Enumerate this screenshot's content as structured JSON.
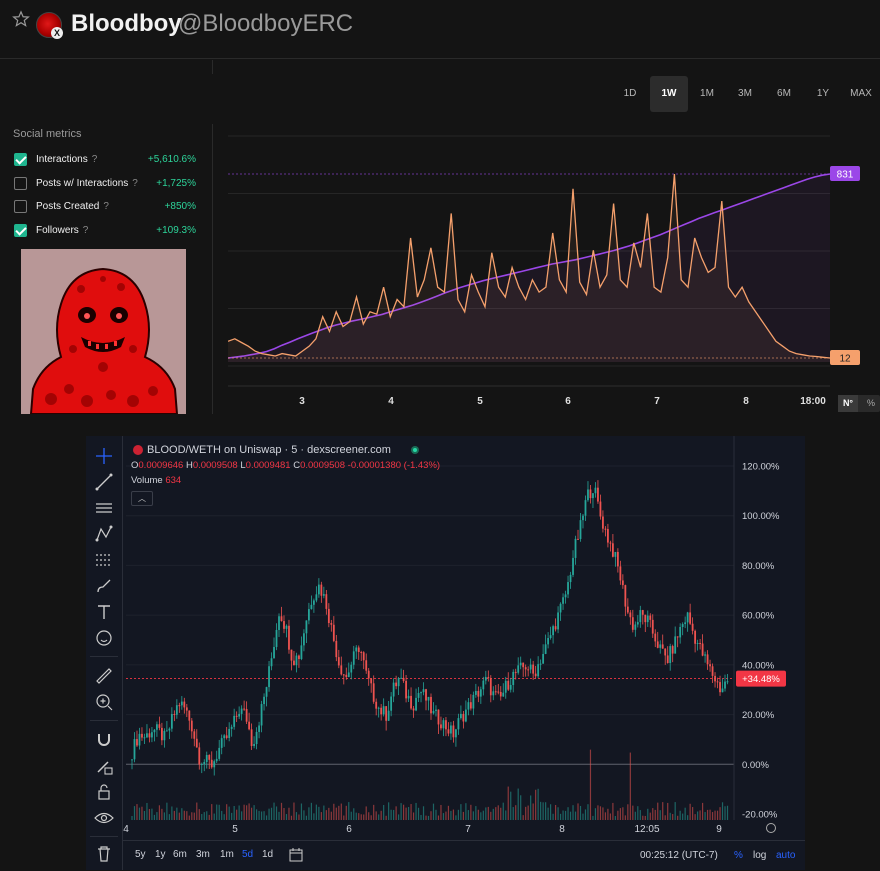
{
  "header": {
    "name": "Bloodboy",
    "handle": "@BloodboyERC"
  },
  "social_metrics": {
    "title": "Social metrics",
    "items": [
      {
        "label": "Interactions",
        "help": "?",
        "value": "+5,610.6%",
        "checked": true
      },
      {
        "label": "Posts w/ Interactions",
        "help": "?",
        "value": "+1,725%",
        "checked": false
      },
      {
        "label": "Posts Created",
        "help": "?",
        "value": "+850%",
        "checked": false
      },
      {
        "label": "Followers",
        "help": "?",
        "value": "+109.3%",
        "checked": true
      }
    ]
  },
  "ranges": [
    "1D",
    "1W",
    "1M",
    "3M",
    "6M",
    "1Y",
    "MAX"
  ],
  "active_range": "1W",
  "unit_toggle": {
    "count": "N°",
    "percent": "%"
  },
  "colors": {
    "followers": "#9b47e8",
    "interactions": "#f5a06c",
    "up": "#26a69a",
    "down": "#ef5350",
    "accent_green": "#2dd49a"
  },
  "chart_data": [
    {
      "type": "line",
      "x_ticks": [
        "3",
        "4",
        "5",
        "6",
        "7",
        "8",
        "18:00"
      ],
      "series": [
        {
          "name": "Followers",
          "color": "#9b47e8",
          "end_label": "831",
          "values": [
            40,
            44,
            48,
            54,
            60,
            68,
            80,
            95,
            108,
            122,
            135,
            148,
            160,
            172,
            182,
            190,
            198,
            205,
            212,
            220,
            228,
            238,
            248,
            258,
            268,
            280,
            292,
            305,
            318,
            330,
            342,
            352,
            362,
            372,
            380,
            388,
            396,
            404,
            412,
            420,
            428,
            436,
            444,
            450,
            456,
            462,
            470,
            478,
            486,
            494,
            502,
            512,
            522,
            534,
            546,
            558,
            570,
            584,
            598,
            612,
            626,
            640,
            652,
            664,
            676,
            688,
            700,
            712,
            724,
            736,
            748,
            760,
            772,
            784,
            796,
            808,
            818,
            826,
            831
          ]
        },
        {
          "name": "Interactions",
          "color": "#f5a06c",
          "end_label": "12",
          "values": [
            80,
            90,
            75,
            60,
            40,
            30,
            25,
            20,
            30,
            25,
            20,
            40,
            60,
            90,
            180,
            120,
            200,
            140,
            160,
            260,
            150,
            200,
            190,
            300,
            180,
            250,
            220,
            500,
            260,
            330,
            460,
            300,
            280,
            600,
            250,
            200,
            350,
            280,
            220,
            440,
            300,
            260,
            380,
            300,
            250,
            330,
            280,
            300,
            520,
            330,
            280,
            700,
            320,
            270,
            450,
            300,
            350,
            640,
            330,
            300,
            480,
            380,
            600,
            300,
            280,
            420,
            760,
            330,
            300,
            500,
            420,
            360,
            380,
            650,
            300,
            260,
            300,
            240,
            200,
            160,
            120,
            80,
            60,
            40,
            30,
            25,
            20,
            18,
            15,
            12
          ]
        }
      ]
    },
    {
      "type": "candlestick",
      "title": "BLOOD/WETH on Uniswap · 5 · dexscreener.com",
      "ohlc": {
        "O": "0.0009646",
        "H": "0.0009508",
        "L": "0.0009481",
        "C": "0.0009508",
        "change": "-0.00001380 (-1.43%)"
      },
      "volume_label": "Volume",
      "volume_value": "634",
      "y_axis_labels": [
        "120.00%",
        "100.00%",
        "80.00%",
        "60.00%",
        "40.00%",
        "20.00%",
        "0.00%",
        "-20.00%"
      ],
      "ylim": [
        -20,
        120
      ],
      "current_label": "+34.48%",
      "current_value": 34.48,
      "x_ticks": [
        "4",
        "5",
        "6",
        "7",
        "8",
        "12:05",
        "9"
      ],
      "close_path": [
        5,
        12,
        11,
        14,
        13,
        10,
        18,
        25,
        22,
        15,
        3,
        1,
        0,
        6,
        10,
        15,
        22,
        20,
        8,
        18,
        30,
        45,
        62,
        55,
        42,
        44,
        58,
        68,
        72,
        65,
        52,
        40,
        35,
        42,
        48,
        36,
        28,
        22,
        20,
        30,
        35,
        28,
        24,
        30,
        26,
        20,
        18,
        15,
        12,
        18,
        22,
        26,
        30,
        34,
        28,
        26,
        32,
        36,
        38,
        40,
        36,
        42,
        48,
        55,
        62,
        70,
        85,
        95,
        108,
        112,
        100,
        92,
        85,
        75,
        62,
        55,
        60,
        58,
        52,
        46,
        42,
        48,
        55,
        60,
        52,
        46,
        40,
        35,
        30,
        34
      ]
    }
  ],
  "dex_bottom": {
    "timeframes": [
      "5y",
      "1y",
      "6m",
      "3m",
      "1m",
      "5d",
      "1d"
    ],
    "active_tf": "5d",
    "clock": "00:25:12 (UTC-7)",
    "pct": "%",
    "log": "log",
    "auto": "auto"
  }
}
